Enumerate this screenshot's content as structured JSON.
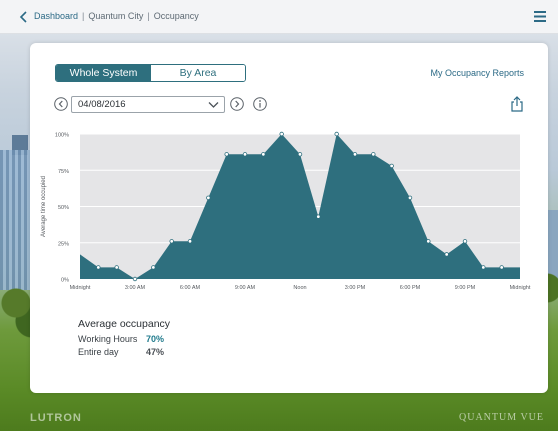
{
  "breadcrumbs": {
    "root": "Dashboard",
    "site": "Quantum City",
    "page": "Occupancy"
  },
  "view_toggle": {
    "options": [
      "Whole System",
      "By Area"
    ],
    "selected": "Whole System"
  },
  "reports_link": "My Occupancy Reports",
  "date": "04/08/2016",
  "colors": {
    "accent": "#2e6f7e",
    "fill": "#2e6f7e",
    "plot_bg": "#e5e5e7",
    "link": "#2c6a86"
  },
  "icons": [
    "back-chevron-icon",
    "hamburger-menu-icon",
    "share-icon",
    "prev-arrow-icon",
    "next-arrow-icon",
    "info-icon",
    "dropdown-chevron-icon"
  ],
  "chart_data": {
    "type": "area",
    "ylabel": "Average time occupied",
    "ylim": [
      0,
      100
    ],
    "yticks": [
      "0%",
      "25%",
      "50%",
      "75%",
      "100%"
    ],
    "xticks": [
      "Midnight",
      "3:00 AM",
      "6:00 AM",
      "9:00 AM",
      "Noon",
      "3:00 PM",
      "6:00 PM",
      "9:00 PM",
      "Midnight"
    ],
    "x_hours": [
      0,
      1,
      2,
      3,
      4,
      5,
      6,
      7,
      8,
      9,
      10,
      11,
      12,
      13,
      14,
      15,
      16,
      17,
      18,
      19,
      20,
      21,
      22,
      23,
      24
    ],
    "values": [
      17,
      8,
      8,
      0,
      8,
      26,
      26,
      56,
      86,
      86,
      86,
      100,
      86,
      43,
      100,
      86,
      86,
      78,
      56,
      26,
      17,
      26,
      8,
      8,
      8
    ],
    "grid": true
  },
  "summary": {
    "title": "Average occupancy",
    "working_label": "Working Hours",
    "working_value": "70%",
    "day_label": "Entire day",
    "day_value": "47%"
  },
  "branding": {
    "left": "LUTRON",
    "right": "QUANTUM VUE"
  }
}
